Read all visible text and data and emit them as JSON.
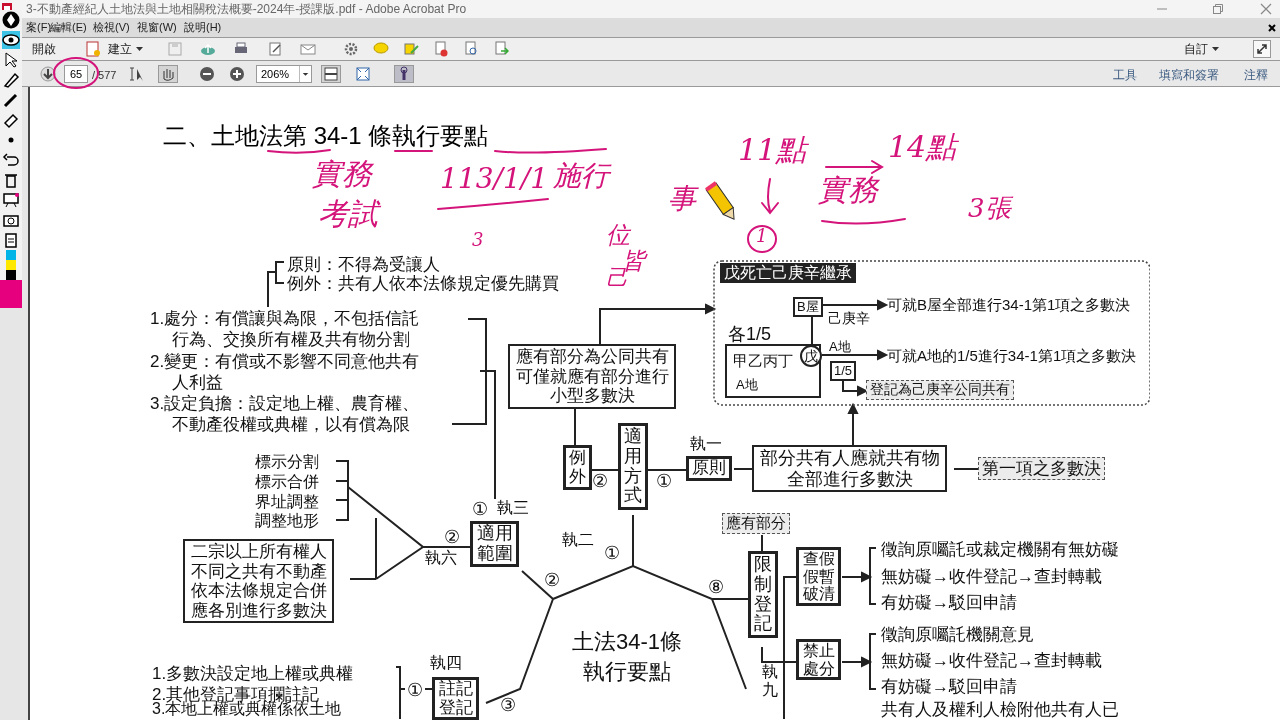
{
  "window": {
    "title": "3-不動產經紀人土地法與土地相關稅法概要-2024年-授課版.pdf - Adobe Acrobat Pro"
  },
  "menu": [
    "案(F)",
    "編輯(E)",
    "檢視(V)",
    "視窗(W)",
    "說明(H)"
  ],
  "toolbar": {
    "open": "開啟",
    "create": "建立",
    "customize": "自訂"
  },
  "navigation": {
    "page": "65",
    "total": "/ 577",
    "zoom": "206%"
  },
  "panes": [
    "工具",
    "填寫和簽署",
    "注釋"
  ],
  "ink_tools": [
    {
      "kind": "pen",
      "selected": false
    },
    {
      "kind": "eye",
      "selected": true
    },
    {
      "kind": "pointer",
      "selected": false
    },
    {
      "kind": "highlighter",
      "selected": false
    },
    {
      "kind": "marker",
      "selected": false
    },
    {
      "kind": "eraser",
      "selected": false
    },
    {
      "kind": "dot",
      "selected": false
    },
    {
      "kind": "undo",
      "selected": false
    },
    {
      "kind": "trash",
      "selected": false
    },
    {
      "kind": "board",
      "selected": false
    },
    {
      "kind": "camera",
      "selected": false
    },
    {
      "kind": "clipboard",
      "selected": false
    }
  ],
  "swatches": [
    {
      "color": "#00b4e8",
      "selected": false
    },
    {
      "color": "#ffe800",
      "selected": false
    },
    {
      "color": "#000000",
      "selected": false
    },
    {
      "color": "#e6007e",
      "selected": true
    }
  ],
  "document": {
    "heading": "二、土地法第 34-1 條執行要點",
    "diagram": [
      {
        "kind": "text",
        "text": "原則：不得為受讓人"
      },
      {
        "kind": "text",
        "text": "例外：共有人依本法條規定優先購買"
      },
      {
        "kind": "text",
        "text": "1.處分：有償讓與為限，不包括信託"
      },
      {
        "kind": "text",
        "text": "行為、交換所有權及共有物分割"
      },
      {
        "kind": "text",
        "text": "2.變更：有償或不影響不同意他共有"
      },
      {
        "kind": "text",
        "text": "人利益"
      },
      {
        "kind": "text",
        "text": "3.設定負擔：設定地上權、農育權、"
      },
      {
        "kind": "text",
        "text": "不動產役權或典權，以有償為限"
      },
      {
        "kind": "text",
        "text": "標示分割"
      },
      {
        "kind": "text",
        "text": "標示合併"
      },
      {
        "kind": "text",
        "text": "界址調整"
      },
      {
        "kind": "text",
        "text": "調整地形"
      },
      {
        "kind": "box",
        "text": "二宗以上所有權人不同之共有不動產依本法條規定合併應各別進行多數決"
      },
      {
        "kind": "text",
        "text": "①"
      },
      {
        "kind": "text",
        "text": "執三"
      },
      {
        "kind": "text",
        "text": "②"
      },
      {
        "kind": "text",
        "text": "執六"
      },
      {
        "kind": "thick",
        "text": "適用範圍"
      },
      {
        "kind": "box",
        "text": "應有部分為公同共有可僅就應有部分進行小型多數決"
      },
      {
        "kind": "vbox",
        "text": "例外"
      },
      {
        "kind": "text",
        "text": "②"
      },
      {
        "kind": "vbox",
        "text": "適用方式"
      },
      {
        "kind": "text",
        "text": "①"
      },
      {
        "kind": "text",
        "text": "執一"
      },
      {
        "kind": "thick",
        "text": "原則"
      },
      {
        "kind": "box",
        "text": "部分共有人應就共有物全部進行多數決"
      },
      {
        "kind": "dashed",
        "text": "第一項之多數決"
      },
      {
        "kind": "dark",
        "text": "戊死亡己庚辛繼承"
      },
      {
        "kind": "small",
        "text": "B屋"
      },
      {
        "kind": "text",
        "text": "己庚辛"
      },
      {
        "kind": "text",
        "text": "可就B屋全部進行34-1第1項之多數決"
      },
      {
        "kind": "text",
        "text": "各1/5"
      },
      {
        "kind": "text",
        "text": "甲乙丙丁"
      },
      {
        "kind": "circled",
        "text": "戊"
      },
      {
        "kind": "text",
        "text": "A地"
      },
      {
        "kind": "text",
        "text": "A地"
      },
      {
        "kind": "text",
        "text": "可就A地的1/5進行34-1第1項之多數決"
      },
      {
        "kind": "small",
        "text": "1/5"
      },
      {
        "kind": "dashed",
        "text": "登記為己庚辛公同共有"
      },
      {
        "kind": "text",
        "text": "執二"
      },
      {
        "kind": "text",
        "text": "①"
      },
      {
        "kind": "text",
        "text": "②"
      },
      {
        "kind": "dashed",
        "text": "應有部分"
      },
      {
        "kind": "text",
        "text": "⑧"
      },
      {
        "kind": "vbox",
        "text": "限制登記"
      },
      {
        "kind": "vtext",
        "text": "執九"
      },
      {
        "kind": "thick",
        "text": "查假假暫破清"
      },
      {
        "kind": "text",
        "text": "徵詢原囑託或裁定機關有無妨礙"
      },
      {
        "kind": "text",
        "text": "無妨礙→收件登記→查封轉載"
      },
      {
        "kind": "text",
        "text": "有妨礙→駁回申請"
      },
      {
        "kind": "thick",
        "text": "禁止處分"
      },
      {
        "kind": "text",
        "text": "徵詢原囑託機關意見"
      },
      {
        "kind": "text",
        "text": "無妨礙→收件登記→查封轉載"
      },
      {
        "kind": "text",
        "text": "有妨礙→駁回申請"
      },
      {
        "kind": "text",
        "text": "執四"
      },
      {
        "kind": "text",
        "text": "1.多數決設定地上權或典權"
      },
      {
        "kind": "text",
        "text": "2.其他登記事項攔註記"
      },
      {
        "kind": "text",
        "text": "3.本地上權或典權係依土地"
      },
      {
        "kind": "text",
        "text": "①"
      },
      {
        "kind": "thick",
        "text": "註記登記"
      },
      {
        "kind": "text",
        "text": "③"
      },
      {
        "kind": "center",
        "text": "土法34-1條執行要點"
      },
      {
        "kind": "text",
        "text": "共有人及權利人檢附他共有人已"
      }
    ],
    "ink_notes": [
      "實務",
      "考試",
      "113/1/1",
      "施行",
      "3",
      "位",
      "己",
      "皆",
      "11點",
      "14點",
      "事",
      "1",
      "實務",
      "3張"
    ]
  }
}
